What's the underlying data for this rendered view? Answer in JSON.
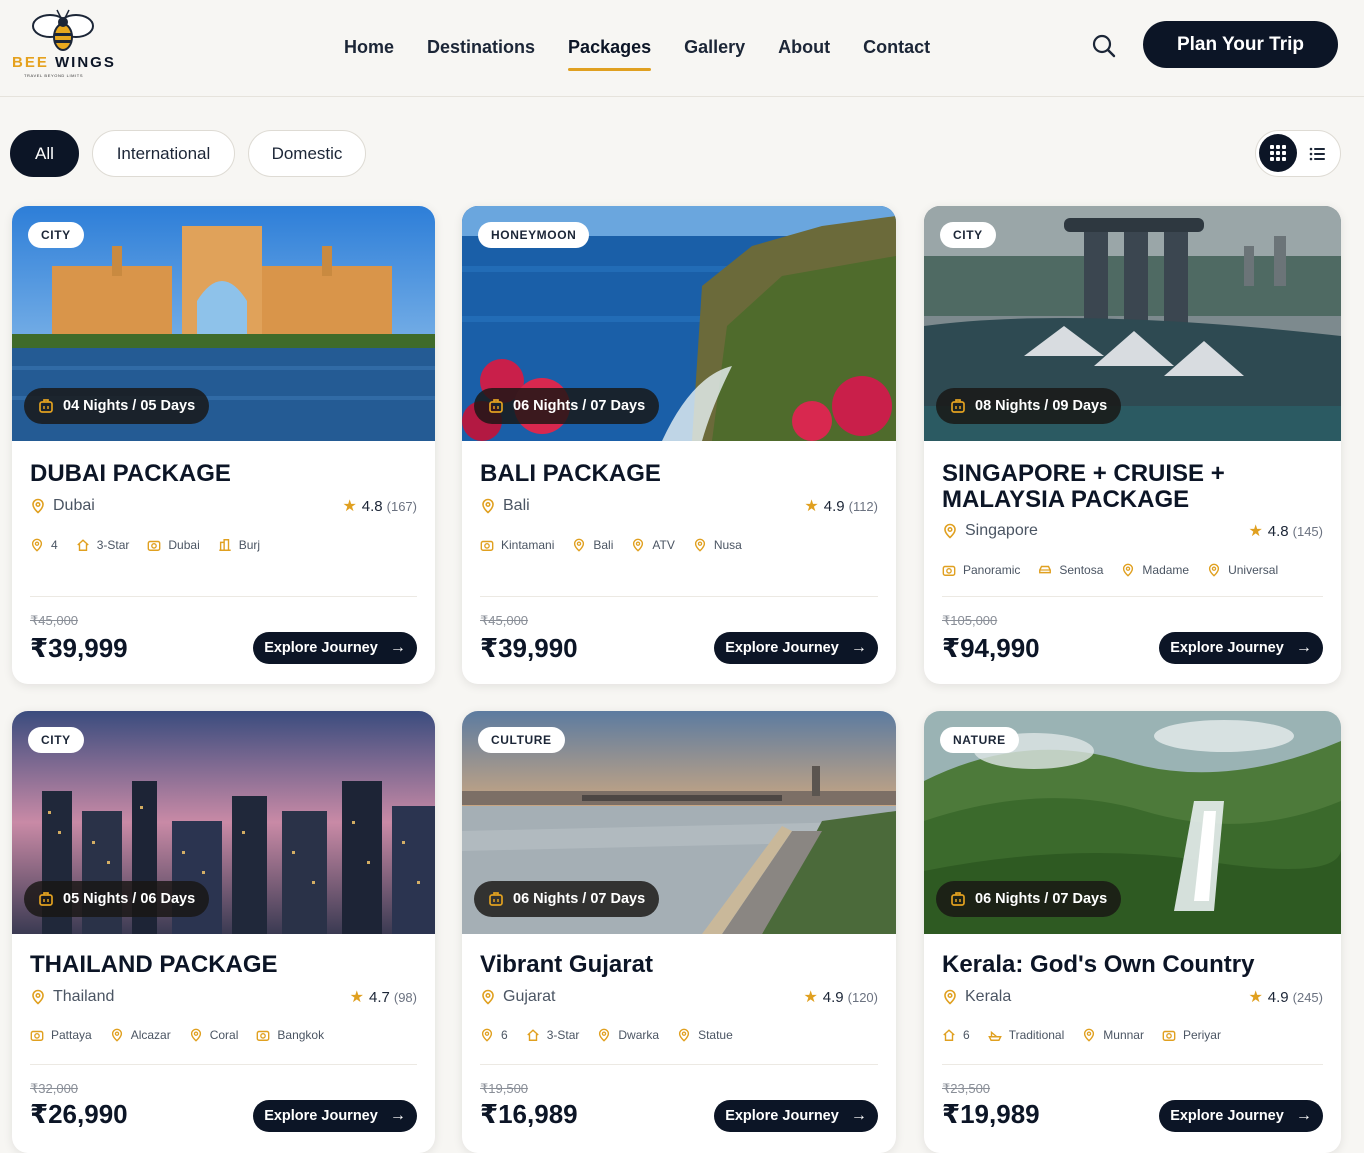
{
  "brand": {
    "name_part1": "BEE",
    "name_part2": "WINGS",
    "tagline": "TRAVEL BEYOND LIMITS"
  },
  "nav": {
    "items": [
      "Home",
      "Destinations",
      "Packages",
      "Gallery",
      "About",
      "Contact"
    ],
    "active": "Packages"
  },
  "header": {
    "cta": "Plan Your Trip",
    "search_icon": "search-icon"
  },
  "filters": {
    "items": [
      "All",
      "International",
      "Domestic"
    ],
    "active": "All"
  },
  "view": {
    "grid_icon": "grid-icon",
    "list_icon": "list-icon",
    "active": "grid"
  },
  "colors": {
    "navy": "#0c1526",
    "accent": "#e0a020",
    "background": "#f7f6f3"
  },
  "cards": [
    {
      "badge": "CITY",
      "duration": "04 Nights / 05 Days",
      "title": "DUBAI PACKAGE",
      "location": "Dubai",
      "rating": "4.8",
      "reviews": "(167)",
      "features": [
        {
          "icon": "pin-icon",
          "label": "4"
        },
        {
          "icon": "home-icon",
          "label": "3-Star"
        },
        {
          "icon": "camera-icon",
          "label": "Dubai"
        },
        {
          "icon": "building-icon",
          "label": "Burj"
        }
      ],
      "old_price": "₹45,000",
      "price": "₹39,999",
      "cta": "Explore Journey"
    },
    {
      "badge": "HONEYMOON",
      "duration": "06 Nights / 07 Days",
      "title": "BALI PACKAGE",
      "location": "Bali",
      "rating": "4.9",
      "reviews": "(112)",
      "features": [
        {
          "icon": "camera-icon",
          "label": "Kintamani"
        },
        {
          "icon": "pin-icon",
          "label": "Bali"
        },
        {
          "icon": "pin-icon",
          "label": "ATV"
        },
        {
          "icon": "pin-icon",
          "label": "Nusa"
        }
      ],
      "old_price": "₹45,000",
      "price": "₹39,990",
      "cta": "Explore Journey"
    },
    {
      "badge": "CITY",
      "duration": "08 Nights / 09 Days",
      "title": "SINGAPORE + CRUISE + MALAYSIA PACKAGE",
      "location": "Singapore",
      "rating": "4.8",
      "reviews": "(145)",
      "features": [
        {
          "icon": "camera-icon",
          "label": "Panoramic"
        },
        {
          "icon": "car-icon",
          "label": "Sentosa"
        },
        {
          "icon": "pin-icon",
          "label": "Madame"
        },
        {
          "icon": "pin-icon",
          "label": "Universal"
        }
      ],
      "old_price": "₹105,000",
      "price": "₹94,990",
      "cta": "Explore Journey"
    },
    {
      "badge": "CITY",
      "duration": "05 Nights / 06 Days",
      "title": "THAILAND PACKAGE",
      "location": "Thailand",
      "rating": "4.7",
      "reviews": "(98)",
      "features": [
        {
          "icon": "camera-icon",
          "label": "Pattaya"
        },
        {
          "icon": "pin-icon",
          "label": "Alcazar"
        },
        {
          "icon": "pin-icon",
          "label": "Coral"
        },
        {
          "icon": "camera-icon",
          "label": "Bangkok"
        }
      ],
      "old_price": "₹32,000",
      "price": "₹26,990",
      "cta": "Explore Journey"
    },
    {
      "badge": "CULTURE",
      "duration": "06 Nights / 07 Days",
      "title": "Vibrant Gujarat",
      "location": "Gujarat",
      "rating": "4.9",
      "reviews": "(120)",
      "features": [
        {
          "icon": "pin-icon",
          "label": "6"
        },
        {
          "icon": "home-icon",
          "label": "3-Star"
        },
        {
          "icon": "pin-icon",
          "label": "Dwarka"
        },
        {
          "icon": "pin-icon",
          "label": "Statue"
        }
      ],
      "old_price": "₹19,500",
      "price": "₹16,989",
      "cta": "Explore Journey"
    },
    {
      "badge": "NATURE",
      "duration": "06 Nights / 07 Days",
      "title": "Kerala: God's Own Country",
      "location": "Kerala",
      "rating": "4.9",
      "reviews": "(245)",
      "features": [
        {
          "icon": "home-icon",
          "label": "6"
        },
        {
          "icon": "boat-icon",
          "label": "Traditional"
        },
        {
          "icon": "pin-icon",
          "label": "Munnar"
        },
        {
          "icon": "camera-icon",
          "label": "Periyar"
        }
      ],
      "old_price": "₹23,500",
      "price": "₹19,989",
      "cta": "Explore Journey"
    }
  ]
}
